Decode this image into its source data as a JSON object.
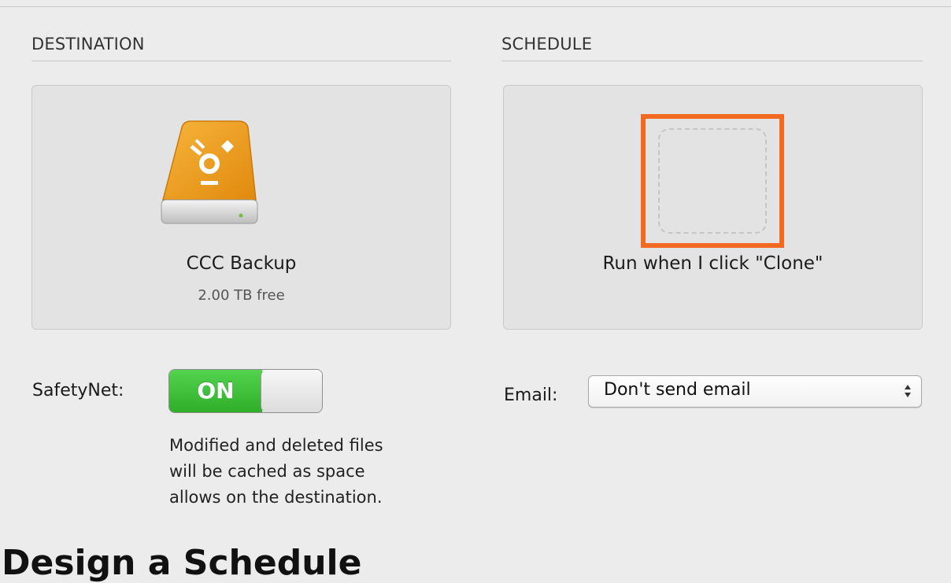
{
  "destination": {
    "section_title": "DESTINATION",
    "drive_icon": "firewire-drive-icon",
    "drive_name": "CCC Backup",
    "drive_free": "2.00 TB free"
  },
  "schedule": {
    "section_title": "SCHEDULE",
    "run_label": "Run when I click \"Clone\"",
    "highlight_color": "#f26a21"
  },
  "safetynet": {
    "label": "SafetyNet:",
    "toggle_state": "ON",
    "toggle_color": "#3cc036",
    "description_lines": [
      "Modified and deleted files",
      "will be cached as space",
      "allows on the destination."
    ]
  },
  "email": {
    "label": "Email:",
    "selected": "Don't send email"
  },
  "footer": {
    "heading": "Design a Schedule"
  }
}
